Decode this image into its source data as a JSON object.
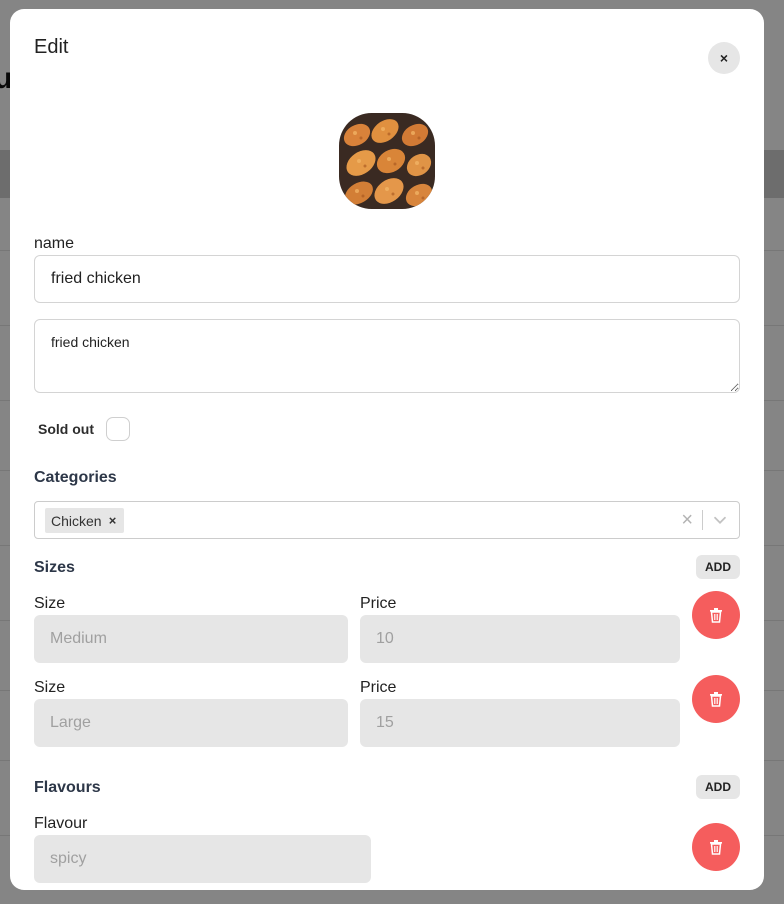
{
  "background": {
    "heading_fragment": "u"
  },
  "modal": {
    "title": "Edit",
    "close_label": "×"
  },
  "item": {
    "name_label": "name",
    "name_value": "fried chicken",
    "description_value": "fried chicken",
    "sold_out_label": "Sold out",
    "sold_out_checked": false
  },
  "categories": {
    "title": "Categories",
    "selected": [
      {
        "label": "Chicken",
        "remove": "×"
      }
    ],
    "clear_icon": "×"
  },
  "sizes": {
    "title": "Sizes",
    "add_label": "ADD",
    "rows": [
      {
        "size_label": "Size",
        "size_value": "Medium",
        "price_label": "Price",
        "price_value": "10"
      },
      {
        "size_label": "Size",
        "size_value": "Large",
        "price_label": "Price",
        "price_value": "15"
      }
    ]
  },
  "flavours": {
    "title": "Flavours",
    "add_label": "ADD",
    "rows": [
      {
        "flavour_label": "Flavour",
        "flavour_value": "spicy"
      }
    ]
  },
  "colors": {
    "delete": "#f55d5d",
    "gray_input": "#e6e6e6",
    "overlay": "rgba(0,0,0,0.48)"
  }
}
